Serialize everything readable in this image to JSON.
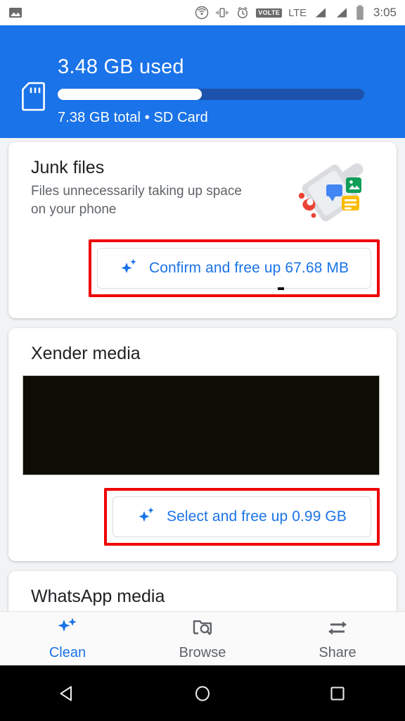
{
  "status_bar": {
    "icons": [
      "image-icon",
      "cast-icon",
      "vibrate-icon",
      "alarm-icon",
      "volte-badge",
      "lte-label",
      "signal-1-icon",
      "signal-2-icon",
      "battery-icon"
    ],
    "volte_label": "VOLTE",
    "lte_label": "LTE",
    "time": "3:05"
  },
  "header": {
    "used_label": "3.48 GB used",
    "total_label": "7.38 GB total • SD Card",
    "progress_percent": 47,
    "storage_icon": "sd-card-icon",
    "background_color": "#1a73e8",
    "progress_fill_color": "#ffffff",
    "progress_track_color": "#1c52ac"
  },
  "cards": {
    "junk": {
      "title": "Junk files",
      "subtitle": "Files unnecessarily taking up space on your phone",
      "illustration": "dustpan-junk-icon",
      "button": {
        "label": "Confirm and free up 67.68 MB",
        "icon": "sparkle-icon",
        "highlighted": true,
        "highlight_color": "#ee0000",
        "text_color": "#1a73e8"
      }
    },
    "xender": {
      "title": "Xender media",
      "thumbnail": "black-media-thumbnail",
      "thumbnail_color": "#0d0d03",
      "button": {
        "label": "Select and free up 0.99 GB",
        "icon": "sparkle-icon",
        "highlighted": true,
        "highlight_color": "#ee0000",
        "text_color": "#1a73e8"
      }
    },
    "whatsapp": {
      "title": "WhatsApp media"
    }
  },
  "bottom_nav": {
    "items": [
      {
        "label": "Clean",
        "icon": "sparkle-icon",
        "active": true
      },
      {
        "label": "Browse",
        "icon": "folder-search-icon",
        "active": false
      },
      {
        "label": "Share",
        "icon": "swap-arrows-icon",
        "active": false
      }
    ],
    "active_color": "#1a73e8",
    "inactive_color": "#5f6368"
  },
  "android_nav": {
    "back": "back-triangle-icon",
    "home": "home-circle-icon",
    "recents": "recents-square-icon"
  }
}
